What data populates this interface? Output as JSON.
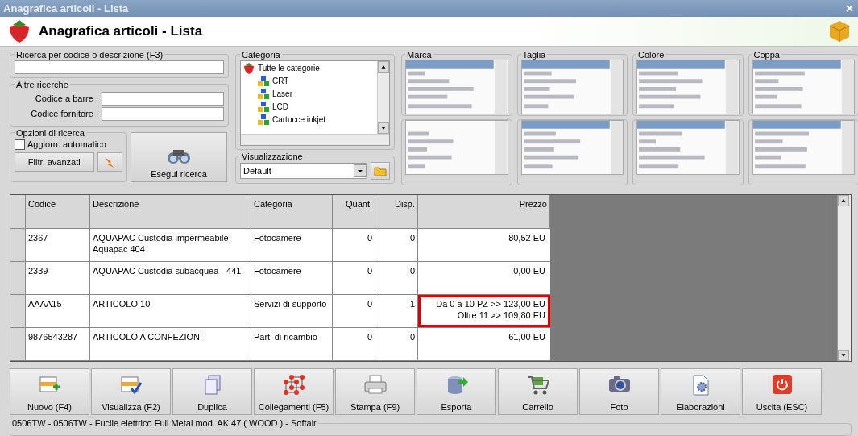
{
  "window": {
    "title": "Anagrafica articoli  - Lista"
  },
  "header": {
    "title": "Anagrafica articoli  - Lista"
  },
  "search": {
    "title": "Ricerca per codice o descrizione (F3)"
  },
  "other_searches": {
    "title": "Altre ricerche",
    "fields": [
      {
        "label": "Codice a barre :"
      },
      {
        "label": "Codice fornitore :"
      }
    ]
  },
  "options": {
    "title": "Opzioni di ricerca",
    "auto_update": {
      "label": "Aggiorn. automatico",
      "checked": false
    },
    "filters_button": "Filtri avanzati"
  },
  "search_button": "Esegui ricerca",
  "category": {
    "title": "Categoria",
    "items": [
      {
        "label": "Tutte le categorie",
        "kind": "root",
        "children": [
          {
            "label": "CRT",
            "kind": "group"
          },
          {
            "label": "Laser",
            "kind": "group"
          },
          {
            "label": "LCD",
            "kind": "group"
          },
          {
            "label": "Cartucce inkjet",
            "kind": "group"
          }
        ]
      }
    ]
  },
  "view": {
    "title": "Visualizzazione",
    "value": "Default"
  },
  "filters": [
    {
      "title": "Marca"
    },
    {
      "title": "Taglia"
    },
    {
      "title": "Colore"
    },
    {
      "title": "Coppa"
    }
  ],
  "table": {
    "columns": [
      "Codice",
      "Descrizione",
      "Categoria",
      "Quant.",
      "Disp.",
      "Prezzo"
    ],
    "rows": [
      {
        "cells": [
          "2367",
          "AQUAPAC Custodia impermeabile Aquapac 404",
          "Fotocamere",
          "0",
          "0"
        ],
        "price": [
          "80,52 EU"
        ],
        "highlighted": false
      },
      {
        "cells": [
          "2339",
          "AQUAPAC Custodia subacquea - 441",
          "Fotocamere",
          "0",
          "0"
        ],
        "price": [
          "0,00 EU"
        ],
        "highlighted": false
      },
      {
        "cells": [
          "AAAA15",
          "ARTICOLO 10",
          "Servizi di supporto",
          "0",
          "-1"
        ],
        "price": [
          "Da 0 a 10 PZ >> 123,00 EU",
          "Oltre 11  >> 109,80 EU"
        ],
        "highlighted": true
      },
      {
        "cells": [
          "9876543287",
          "ARTICOLO A CONFEZIONI",
          "Parti di ricambio",
          "0",
          "0"
        ],
        "price": [
          "61,00 EU"
        ],
        "highlighted": false
      }
    ]
  },
  "toolbar": [
    {
      "label": "Nuovo (F4)",
      "kind": "new"
    },
    {
      "label": "Visualizza (F2)",
      "kind": "view"
    },
    {
      "label": "Duplica",
      "kind": "copy"
    },
    {
      "label": "Collegamenti (F5)",
      "kind": "links"
    },
    {
      "label": "Stampa (F9)",
      "kind": "print"
    },
    {
      "label": "Esporta",
      "kind": "export"
    },
    {
      "label": "Carrello",
      "kind": "cart"
    },
    {
      "label": "Foto",
      "kind": "photo"
    },
    {
      "label": "Elaborazioni",
      "kind": "process"
    },
    {
      "label": "Uscita (ESC)",
      "kind": "exit"
    }
  ],
  "status": {
    "text": "0506TW - 0506TW  - Fucile elettrico Full Metal mod. AK 47 ( WOOD ) - Softair"
  }
}
